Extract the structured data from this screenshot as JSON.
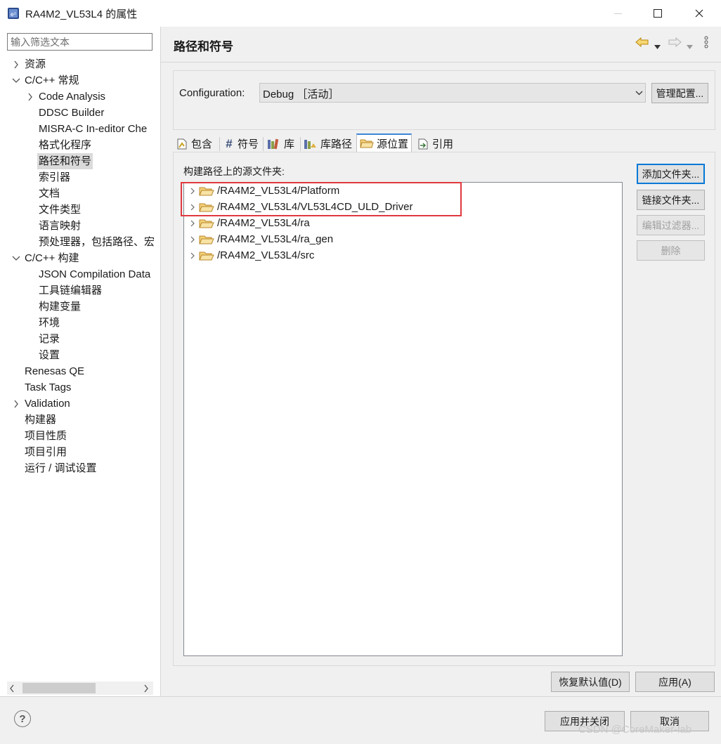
{
  "window": {
    "title": "RA4M2_VL53L4 的属性",
    "minimize_glyph": "—",
    "maximize_glyph": "☐",
    "close_glyph": "✕"
  },
  "filter": {
    "placeholder": "输入筛选文本"
  },
  "tree": [
    {
      "label": "资源",
      "level": 0,
      "expander": "collapsed"
    },
    {
      "label": "C/C++ 常规",
      "level": 0,
      "expander": "expanded"
    },
    {
      "label": "Code Analysis",
      "level": 1,
      "expander": "collapsed"
    },
    {
      "label": "DDSC Builder",
      "level": 1,
      "expander": "none"
    },
    {
      "label": "MISRA-C In-editor Che",
      "level": 1,
      "expander": "none"
    },
    {
      "label": "格式化程序",
      "level": 1,
      "expander": "none"
    },
    {
      "label": "路径和符号",
      "level": 1,
      "expander": "none",
      "selected": true
    },
    {
      "label": "索引器",
      "level": 1,
      "expander": "none"
    },
    {
      "label": "文档",
      "level": 1,
      "expander": "none"
    },
    {
      "label": "文件类型",
      "level": 1,
      "expander": "none"
    },
    {
      "label": "语言映射",
      "level": 1,
      "expander": "none"
    },
    {
      "label": "预处理器，包括路径、宏",
      "level": 1,
      "expander": "none"
    },
    {
      "label": "C/C++ 构建",
      "level": 0,
      "expander": "expanded"
    },
    {
      "label": "JSON Compilation Data",
      "level": 1,
      "expander": "none"
    },
    {
      "label": "工具链编辑器",
      "level": 1,
      "expander": "none"
    },
    {
      "label": "构建变量",
      "level": 1,
      "expander": "none"
    },
    {
      "label": "环境",
      "level": 1,
      "expander": "none"
    },
    {
      "label": "记录",
      "level": 1,
      "expander": "none"
    },
    {
      "label": "设置",
      "level": 1,
      "expander": "none"
    },
    {
      "label": "Renesas QE",
      "level": 0,
      "expander": "none"
    },
    {
      "label": "Task Tags",
      "level": 0,
      "expander": "none"
    },
    {
      "label": "Validation",
      "level": 0,
      "expander": "collapsed"
    },
    {
      "label": "构建器",
      "level": 0,
      "expander": "none"
    },
    {
      "label": "项目性质",
      "level": 0,
      "expander": "none"
    },
    {
      "label": "项目引用",
      "level": 0,
      "expander": "none"
    },
    {
      "label": "运行 / 调试设置",
      "level": 0,
      "expander": "none"
    }
  ],
  "page": {
    "title": "路径和符号",
    "config_label": "Configuration:",
    "config_value": "Debug ［活动］",
    "manage_button": "管理配置..."
  },
  "tabs": [
    {
      "label": "包含",
      "icon": "include-icon"
    },
    {
      "label": "符号",
      "icon": "hash-icon"
    },
    {
      "label": "库",
      "icon": "library-icon"
    },
    {
      "label": "库路径",
      "icon": "library-path-icon"
    },
    {
      "label": "源位置",
      "icon": "source-folder-icon",
      "active": true
    },
    {
      "label": "引用",
      "icon": "reference-icon"
    }
  ],
  "source_panel": {
    "label": "构建路径上的源文件夹:",
    "folders": [
      "/RA4M2_VL53L4/Platform",
      "/RA4M2_VL53L4/VL53L4CD_ULD_Driver",
      "/RA4M2_VL53L4/ra",
      "/RA4M2_VL53L4/ra_gen",
      "/RA4M2_VL53L4/src"
    ],
    "buttons": {
      "add_folder": "添加文件夹...",
      "link_folder": "链接文件夹...",
      "edit_filter": "编辑过滤器...",
      "delete": "删除"
    }
  },
  "footer": {
    "restore_defaults": "恢复默认值(D)",
    "apply": "应用(A)",
    "apply_close": "应用并关闭",
    "cancel": "取消",
    "help_glyph": "?"
  },
  "watermark": "CSDN @CoreMaker-lab",
  "colors": {
    "accent": "#0078d7",
    "highlight": "#e0393e",
    "folder": "#e8b04a"
  }
}
